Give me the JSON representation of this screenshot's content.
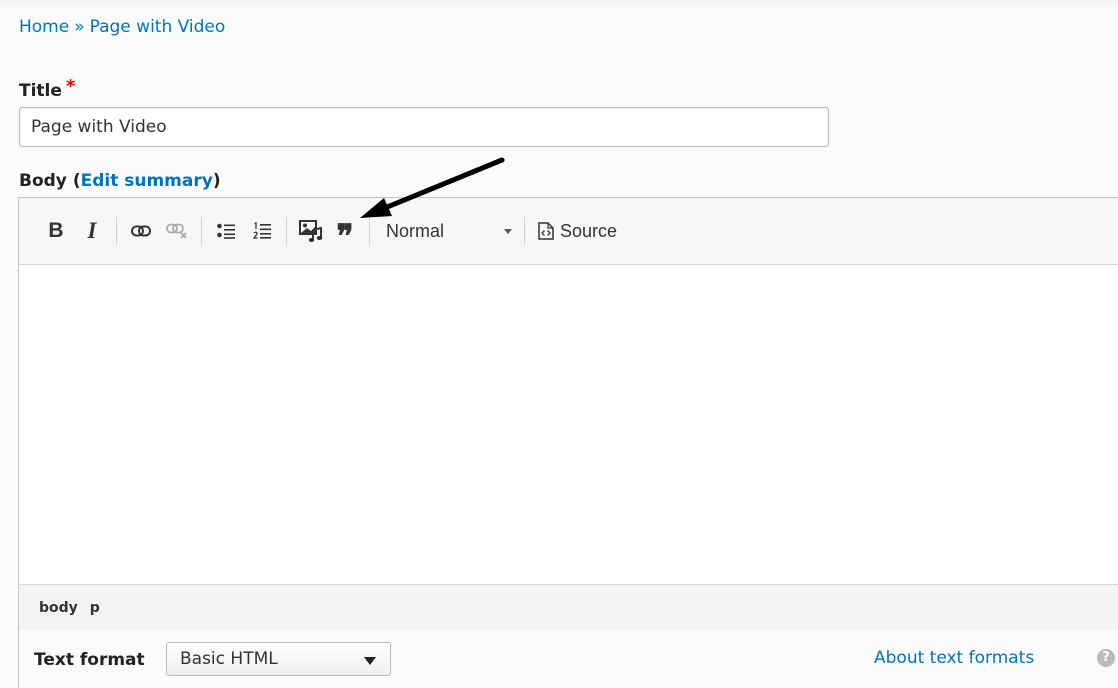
{
  "breadcrumb": {
    "home": "Home",
    "separator": "»",
    "current": "Page with Video"
  },
  "title_field": {
    "label": "Title",
    "required_mark": "*",
    "value": "Page with Video"
  },
  "body_field": {
    "label": "Body",
    "open_paren": "(",
    "edit_summary": "Edit summary",
    "close_paren": ")"
  },
  "toolbar": {
    "bold": "B",
    "italic": "I",
    "blockquote": "❞",
    "format_value": "Normal",
    "source": "Source",
    "icons": [
      "bold-icon",
      "italic-icon",
      "link-icon",
      "unlink-icon",
      "bulleted-list-icon",
      "numbered-list-icon",
      "media-embed-icon",
      "blockquote-icon",
      "source-icon"
    ]
  },
  "pathbar": {
    "items": [
      "body",
      "p"
    ]
  },
  "text_format": {
    "label": "Text format",
    "selected": "Basic HTML",
    "about_link": "About text formats",
    "help": "?"
  },
  "colors": {
    "link": "#0074bd",
    "required": "#e00000",
    "annotation_arrow": "#000000"
  }
}
